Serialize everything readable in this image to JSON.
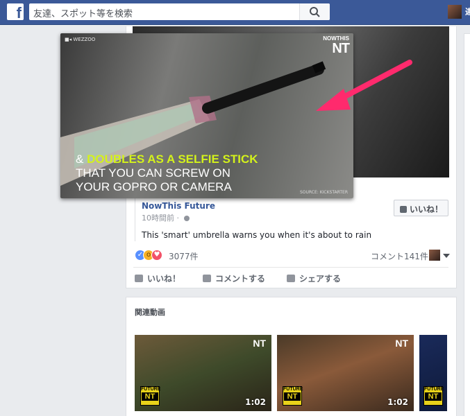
{
  "topbar": {
    "search_placeholder": "友達、スポット等を検索",
    "logo": "f",
    "profile_name": "達"
  },
  "post": {
    "page_name": "NowThis Future",
    "time": "10時間前",
    "like_page_button": "いいね！",
    "description": "This 'smart' umbrella warns you when it's about to rain",
    "reaction_count": "3077件",
    "comment_count": "コメント141件",
    "actions": {
      "like": "いいね！",
      "comment": "コメントする",
      "share": "シェアする"
    }
  },
  "video": {
    "source_tag": "WEZZOO",
    "brand_top": "NOWTHIS",
    "brand_logo": "NT",
    "caption_prefix": "& ",
    "caption_highlight": "DOUBLES AS A SELFIE STICK",
    "caption_line2": "THAT YOU CAN SCREW ON",
    "caption_line3": "YOUR GOPRO OR CAMERA",
    "source": "SOURCE: KICKSTARTER"
  },
  "related": {
    "title": "関連動画",
    "videos": [
      {
        "duration": "1:02",
        "badge_top": "FUTURE",
        "badge_logo": "NT",
        "brand_logo": "NT"
      },
      {
        "duration": "1:02",
        "badge_top": "FUTURE",
        "badge_logo": "NT",
        "brand_logo": "NT"
      },
      {
        "badge_top": "FUTURE",
        "badge_logo": "NT"
      }
    ]
  },
  "colors": {
    "facebook_blue": "#3b5998",
    "arrow_pink": "#ff2a6d",
    "highlight": "#d4f21b"
  },
  "icons": [
    "search-icon",
    "thumbs-up-icon",
    "comment-icon",
    "share-icon",
    "globe-icon",
    "video-camera-icon"
  ]
}
